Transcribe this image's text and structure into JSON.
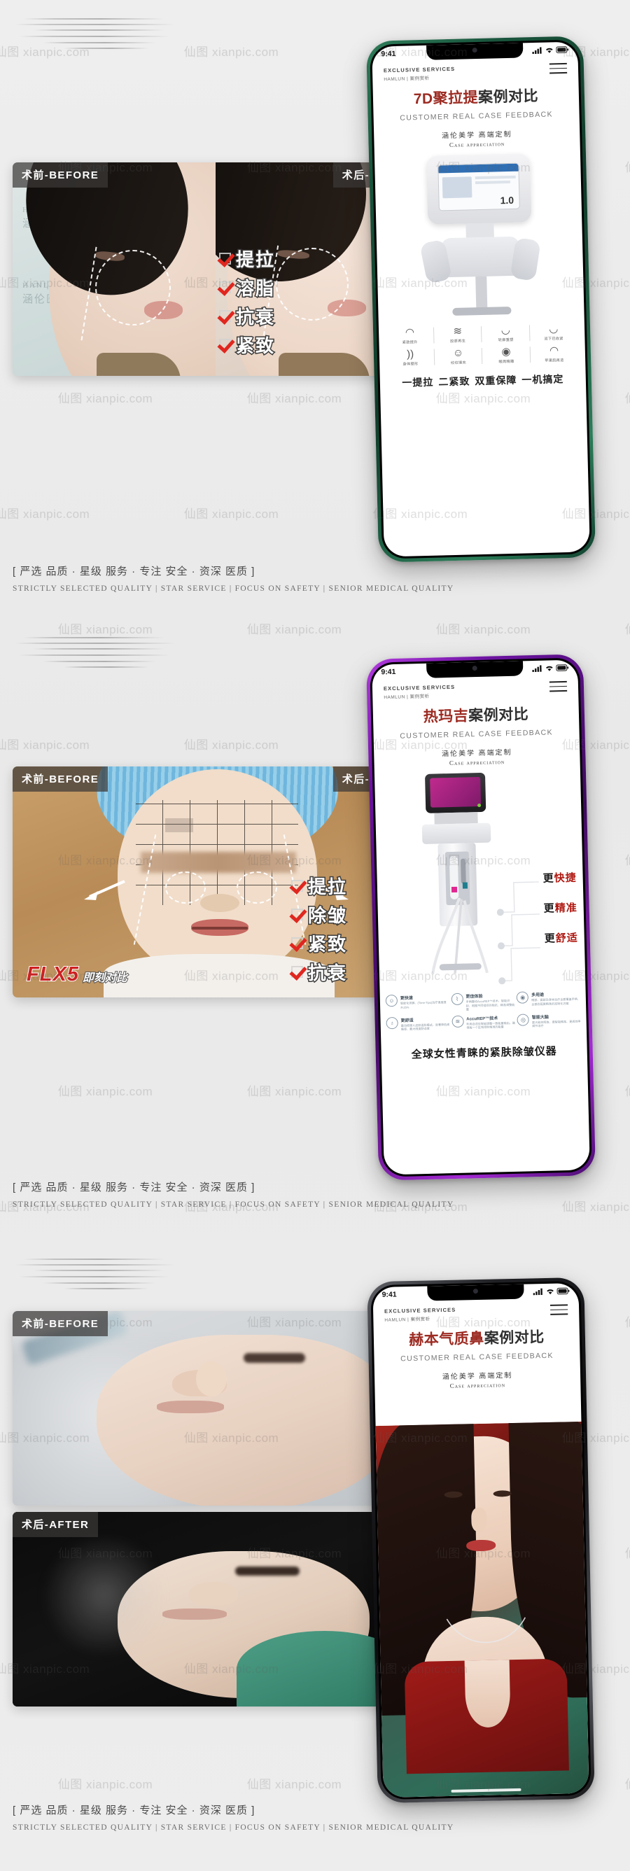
{
  "watermark": {
    "text": "仙图 xianpic.com"
  },
  "footer": {
    "cn_parts": [
      "[ 严选 ",
      "品质",
      " · 星级 ",
      "服务",
      " · 专注 ",
      "安全",
      " · 资深 ",
      "医质",
      " ]"
    ],
    "cn_full": "[ 严选 品质 · 星级 服务 · 专注 安全 · 资深 医质 ]",
    "en": "STRICTLY SELECTED QUALITY  |  STAR SERVICE  |  FOCUS ON SAFETY  |  SENIOR MEDICAL QUALITY"
  },
  "labels": {
    "before": "术前-BEFORE",
    "after": "术后-AFTER"
  },
  "phone_common": {
    "status_time": "9:41",
    "brand_en": "EXCLUSIVE SERVICES",
    "brand_cn": "HAMLUN | 案例赏析",
    "subtitle_en": "CUSTOMER REAL CASE FEEDBACK",
    "aesthetic_cn": "涵伦美学  高端定制",
    "aesthetic_en": "Case appreciation",
    "icons": {
      "signal": "signal-icon",
      "wifi": "wifi-icon",
      "battery": "battery-icon",
      "menu": "hamburger-menu-icon",
      "camera": "front-camera-icon"
    }
  },
  "sections": [
    {
      "id": "section-7d",
      "frame_color": "#19543c",
      "frame_hi": "#3f9b6d",
      "title_red": "7D聚拉提",
      "title_dark": "案例对比",
      "checklist": [
        "提拉",
        "溶脂",
        "抗衰",
        "紧致"
      ],
      "device_icons": [
        {
          "glyph": "◠",
          "label": "紧致提升"
        },
        {
          "glyph": "≋",
          "label": "胶原再生"
        },
        {
          "glyph": "◡",
          "label": "轮廓重塑"
        },
        {
          "glyph": "◡",
          "label": "双下巴收紧"
        },
        {
          "glyph": "))",
          "label": "身体塑形"
        },
        {
          "glyph": "☺",
          "label": "纹纹填充"
        },
        {
          "glyph": "◉",
          "label": "眼周精雕"
        },
        {
          "glyph": "◠",
          "label": "苹果肌再造"
        }
      ],
      "slogan_items": [
        "一提拉",
        "二紧致",
        "双重保障",
        "一机搞定"
      ],
      "screen_value": "1.0"
    },
    {
      "id": "section-thermage",
      "frame_color": "#4d0d6e",
      "frame_hi": "#a32ddc",
      "title_red": "热玛吉",
      "title_dark": "案例对比",
      "checklist": [
        "提拉",
        "除皱",
        "紧致",
        "抗衰"
      ],
      "photo_badge_big": "FLX5",
      "photo_badge_small": "即刻对比",
      "features": [
        {
          "prefix": "更",
          "accent": "快捷"
        },
        {
          "prefix": "更",
          "accent": "精准"
        },
        {
          "prefix": "更",
          "accent": "舒适"
        }
      ],
      "bullets": [
        {
          "title": "更快速",
          "desc": "智能化测算、(Time-Tips)治疗速度提升25%"
        },
        {
          "title": "更佳体验",
          "desc": "手柄震动AccuREP™技术，智能识别、根据不同组织的阻抗、精准调整能量"
        },
        {
          "title": "多用途",
          "desc": "眼部、面部及身体治疗全面覆盖手柄、全面匹配更精准的定制化方案"
        },
        {
          "title": "更舒适",
          "desc": "震动按摩人皮肤温和模式、显著降低疼痛感、最大限度舒适度"
        },
        {
          "title": "AccuREP™技术",
          "desc": "利用自适应智能调整一致能量输出，确保每一个区域得到精准的能量"
        },
        {
          "title": "智能大脑",
          "desc": "更大能效释放、更智能精准、更高效率调节治疗"
        }
      ],
      "bottom_slogan": "全球女性青睐的紧肤除皱仪器"
    },
    {
      "id": "section-nose",
      "frame_color": "#141414",
      "frame_hi": "#55565b",
      "title_red": "赫本气质鼻",
      "title_dark": "案例对比"
    }
  ]
}
